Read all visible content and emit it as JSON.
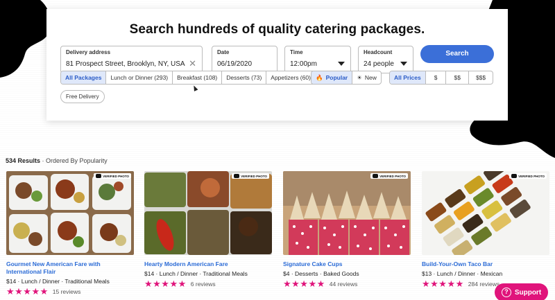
{
  "search": {
    "title": "Search hundreds of quality catering packages.",
    "address_label": "Delivery address",
    "address_value": "81 Prospect Street, Brooklyn, NY, USA",
    "clear_icon": "close-icon",
    "date_label": "Date",
    "date_value": "06/19/2020",
    "time_label": "Time",
    "time_value": "12:00pm",
    "headcount_label": "Headcount",
    "headcount_value": "24 people",
    "button_label": "Search",
    "button_color": "#3b6fd8"
  },
  "filters": {
    "categories": [
      {
        "label": "All Packages",
        "active": true
      },
      {
        "label": "Lunch or Dinner (293)",
        "active": false
      },
      {
        "label": "Breakfast (108)",
        "active": false
      },
      {
        "label": "Desserts (73)",
        "active": false
      },
      {
        "label": "Appetizers (60)",
        "active": false
      }
    ],
    "sort": [
      {
        "label": "Popular",
        "icon": "flame-icon",
        "active": true
      },
      {
        "label": "New",
        "icon": "sun-icon",
        "active": false
      }
    ],
    "prices": [
      {
        "label": "All Prices",
        "active": true
      },
      {
        "label": "$",
        "active": false
      },
      {
        "label": "$$",
        "active": false
      },
      {
        "label": "$$$",
        "active": false
      }
    ],
    "free_delivery": "Free Delivery"
  },
  "results": {
    "count": "534 Results",
    "ordering": " · Ordered By Popularity"
  },
  "verified_label": "VERIFIED PHOTO",
  "cards": [
    {
      "title": "Gourmet New American Fare with International Flair",
      "meta": "$14 · Lunch / Dinner · Traditional Meals",
      "stars": "★★★★★",
      "rating": 5,
      "reviews": "15 reviews"
    },
    {
      "title": "Hearty Modern American Fare",
      "meta": "$14 · Lunch / Dinner · Traditional Meals",
      "stars": "★★★★★",
      "rating": 5,
      "reviews": "6 reviews"
    },
    {
      "title": "Signature Cake Cups",
      "meta": "$4 · Desserts · Baked Goods",
      "stars": "★★★★★",
      "rating": 5,
      "reviews": "44 reviews"
    },
    {
      "title": "Build-Your-Own Taco Bar",
      "meta": "$13 · Lunch / Dinner · Mexican",
      "stars": "★★★★★",
      "rating": 5,
      "reviews": "284 reviews"
    }
  ],
  "support": {
    "label": "Support",
    "color": "#e0147b"
  }
}
